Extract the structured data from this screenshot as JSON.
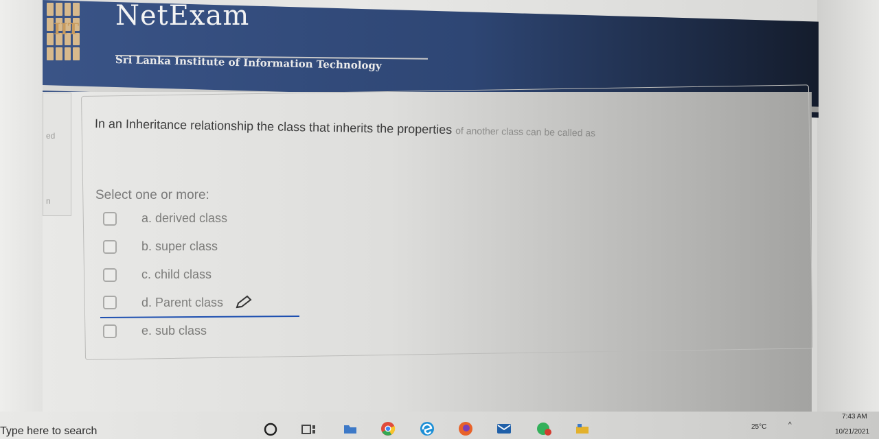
{
  "header": {
    "logo_text": "IIT",
    "brand": "NetExam",
    "institute": "Sri Lanka Institute of Information Technology"
  },
  "side_nav": {
    "items": [
      "ed",
      "n"
    ]
  },
  "question": {
    "text": "In an Inheritance relationship the class that inherits the properties",
    "text_faded": "of another class can be called as",
    "hint": "Select one or more:",
    "options": [
      {
        "label": "a. derived class",
        "checked": false
      },
      {
        "label": "b. super class",
        "checked": false
      },
      {
        "label": "c. child class",
        "checked": false
      },
      {
        "label": "d. Parent class",
        "checked": false
      },
      {
        "label": "e. sub class",
        "checked": false
      }
    ],
    "annotation_icon": "pencil-icon"
  },
  "taskbar": {
    "search_placeholder": "Type here to search",
    "icons": [
      "cortana-icon",
      "task-view-icon",
      "folder-icon",
      "chrome-icon",
      "edge-icon",
      "firefox-icon",
      "mail-icon",
      "whatsapp-icon",
      "explorer-icon"
    ],
    "weather": "25°C",
    "time": "7:43 AM",
    "date": "10/21/2021",
    "accent": "#1d4fb0"
  }
}
